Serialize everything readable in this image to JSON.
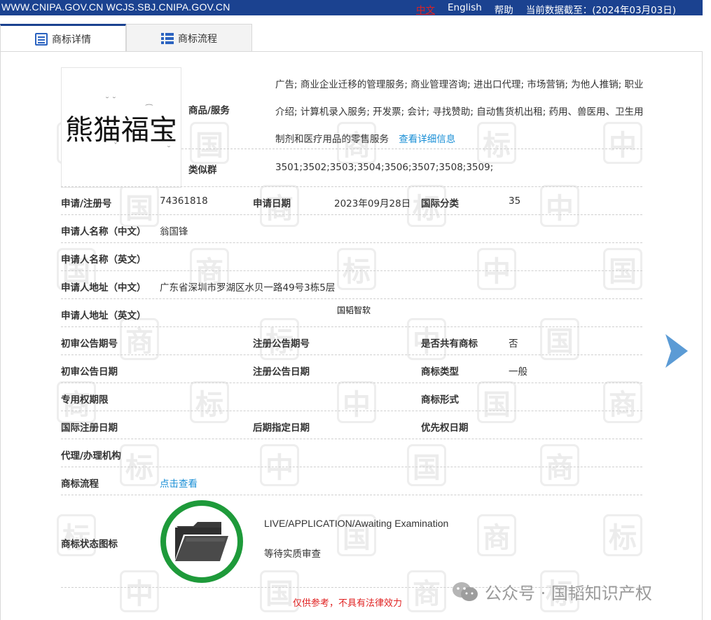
{
  "topbar": {
    "domains": "WWW.CNIPA.GOV.CN WCJS.SBJ.CNIPA.GOV.CN",
    "lang_cn": "中文",
    "lang_en": "English",
    "help": "帮助",
    "data_date": "当前数据截至：(2024年03月03日)"
  },
  "tabs": [
    {
      "label": "商标详情",
      "icon": "document-icon",
      "active": true
    },
    {
      "label": "商标流程",
      "icon": "list-icon",
      "active": false
    }
  ],
  "trademark": {
    "mark_text": "熊猫福宝",
    "goods_label": "商品/服务",
    "goods_text": "广告; 商业企业迁移的管理服务; 商业管理咨询; 进出口代理; 市场营销; 为他人推销; 职业介绍; 计算机录入服务; 开发票; 会计; 寻找赞助; 自动售货机出租; 药用、兽医用、卫生用制剂和医疗用品的零售服务",
    "goods_link": "查看详细信息",
    "similar_label": "类似群",
    "similar_value": "3501;3502;3503;3504;3506;3507;3508;3509;"
  },
  "fields": {
    "reg_no_label": "申请/注册号",
    "reg_no_value": "74361818",
    "app_date_label": "申请日期",
    "app_date_value": "2023年09月28日",
    "intl_class_label": "国际分类",
    "intl_class_value": "35",
    "applicant_cn_label": "申请人名称（中文）",
    "applicant_cn_value": "翁国锋",
    "applicant_en_label": "申请人名称（英文）",
    "address_cn_label": "申请人地址（中文）",
    "address_cn_value": "广东省深圳市罗湖区水贝一路49号3栋5层",
    "address_en_label": "申请人地址（英文）",
    "overlay_note": "国韬智软",
    "prelim_no_label": "初审公告期号",
    "reg_pub_no_label": "注册公告期号",
    "shared_label": "是否共有商标",
    "shared_value": "否",
    "prelim_date_label": "初审公告日期",
    "reg_pub_date_label": "注册公告日期",
    "type_label": "商标类型",
    "type_value": "一般",
    "exclusive_label": "专用权期限",
    "form_label": "商标形式",
    "intl_reg_date_label": "国际注册日期",
    "later_date_label": "后期指定日期",
    "priority_label": "优先权日期",
    "agent_label": "代理/办理机构",
    "flow_label": "商标流程",
    "flow_link": "点击查看",
    "status_icon_label": "商标状态图标",
    "status_en": "LIVE/APPLICATION/Awaiting Examination",
    "status_cn": "等待实质审查"
  },
  "footer": {
    "disclaimer": "仅供参考，不具有法律效力",
    "wechat_text": "公众号 · 国韬知识产权"
  },
  "watermark_chars": [
    "中",
    "国",
    "商",
    "标"
  ],
  "colors": {
    "topbar_bg": "#1b4290",
    "accent_blue": "#2b63c0",
    "link": "#1a8fd6",
    "status_green": "#1e9a3a",
    "disclaimer_red": "#e02020",
    "arrow_blue": "#5b9bd5"
  },
  "icons": {
    "tab1": "document-icon",
    "tab2": "list-icon",
    "status": "folder-open-icon",
    "next": "chevron-right-icon",
    "wechat": "wechat-icon"
  }
}
